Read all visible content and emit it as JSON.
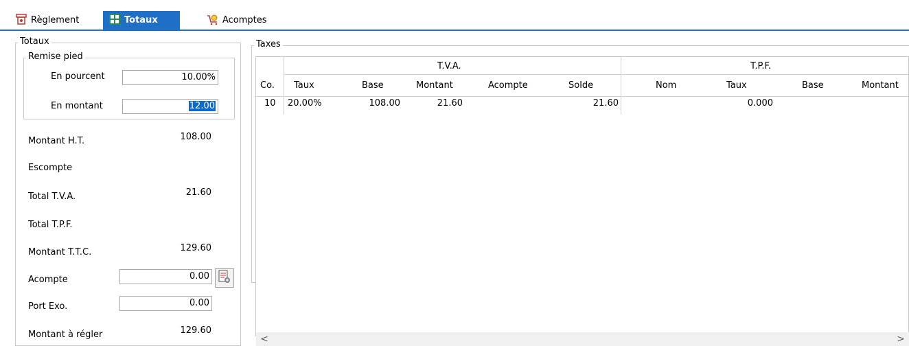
{
  "tabs": [
    {
      "label": "Règlement"
    },
    {
      "label": "Totaux"
    },
    {
      "label": "Acomptes"
    }
  ],
  "totaux": {
    "legend": "Totaux",
    "remise": {
      "legend": "Remise pied",
      "en_pourcent_label": "En pourcent",
      "en_pourcent_value": "10.00%",
      "en_montant_label": "En montant",
      "en_montant_value": "12.00"
    },
    "montant_ht_label": "Montant H.T.",
    "montant_ht_value": "108.00",
    "escompte_label": "Escompte",
    "total_tva_label": "Total T.V.A.",
    "total_tva_value": "21.60",
    "total_tpf_label": "Total T.P.F.",
    "montant_ttc_label": "Montant T.T.C.",
    "montant_ttc_value": "129.60",
    "acompte_label": "Acompte",
    "acompte_value": "0.00",
    "port_exo_label": "Port Exo.",
    "port_exo_value": "0.00",
    "montant_regler_label": "Montant à régler",
    "montant_regler_value": "129.60"
  },
  "taxes": {
    "legend": "Taxes",
    "group_tva": "T.V.A.",
    "group_tpf": "T.P.F.",
    "columns": [
      "Co.",
      "Taux",
      "Base",
      "Montant",
      "Acompte",
      "Solde",
      "Nom",
      "Taux",
      "Base",
      "Montant"
    ],
    "rows": [
      [
        "10",
        "20.00%",
        "108.00",
        "21.60",
        "",
        "21.60",
        "",
        "0.000",
        "",
        ""
      ]
    ]
  },
  "scroll": {
    "left": "<",
    "right": ">"
  },
  "colors": {
    "accent": "#1f6fc6",
    "selection": "#0a6ad0"
  }
}
